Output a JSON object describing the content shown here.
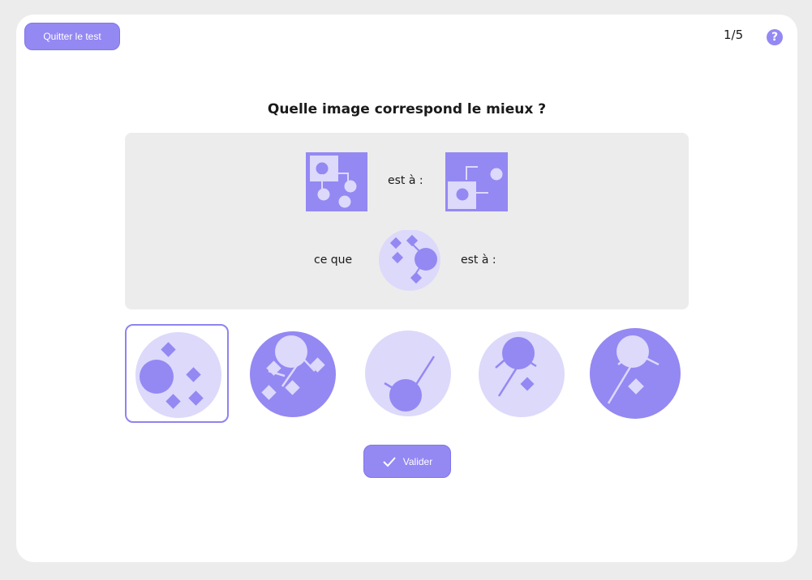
{
  "header": {
    "quit_label": "Quitter le test",
    "progress": "1/5",
    "help_glyph": "?"
  },
  "question": "Quelle image correspond le mieux ?",
  "analogy": {
    "connector_1": "est à :",
    "connector_2": "ce que",
    "connector_3": "est à :"
  },
  "options": [
    {
      "id": "option-1",
      "selected": true
    },
    {
      "id": "option-2",
      "selected": false
    },
    {
      "id": "option-3",
      "selected": false
    },
    {
      "id": "option-4",
      "selected": false
    },
    {
      "id": "option-5",
      "selected": false
    }
  ],
  "validate_label": "Valider",
  "colors": {
    "accent": "#9488f3",
    "accent_light": "#dcd9fb",
    "panel_bg": "#ececec"
  }
}
